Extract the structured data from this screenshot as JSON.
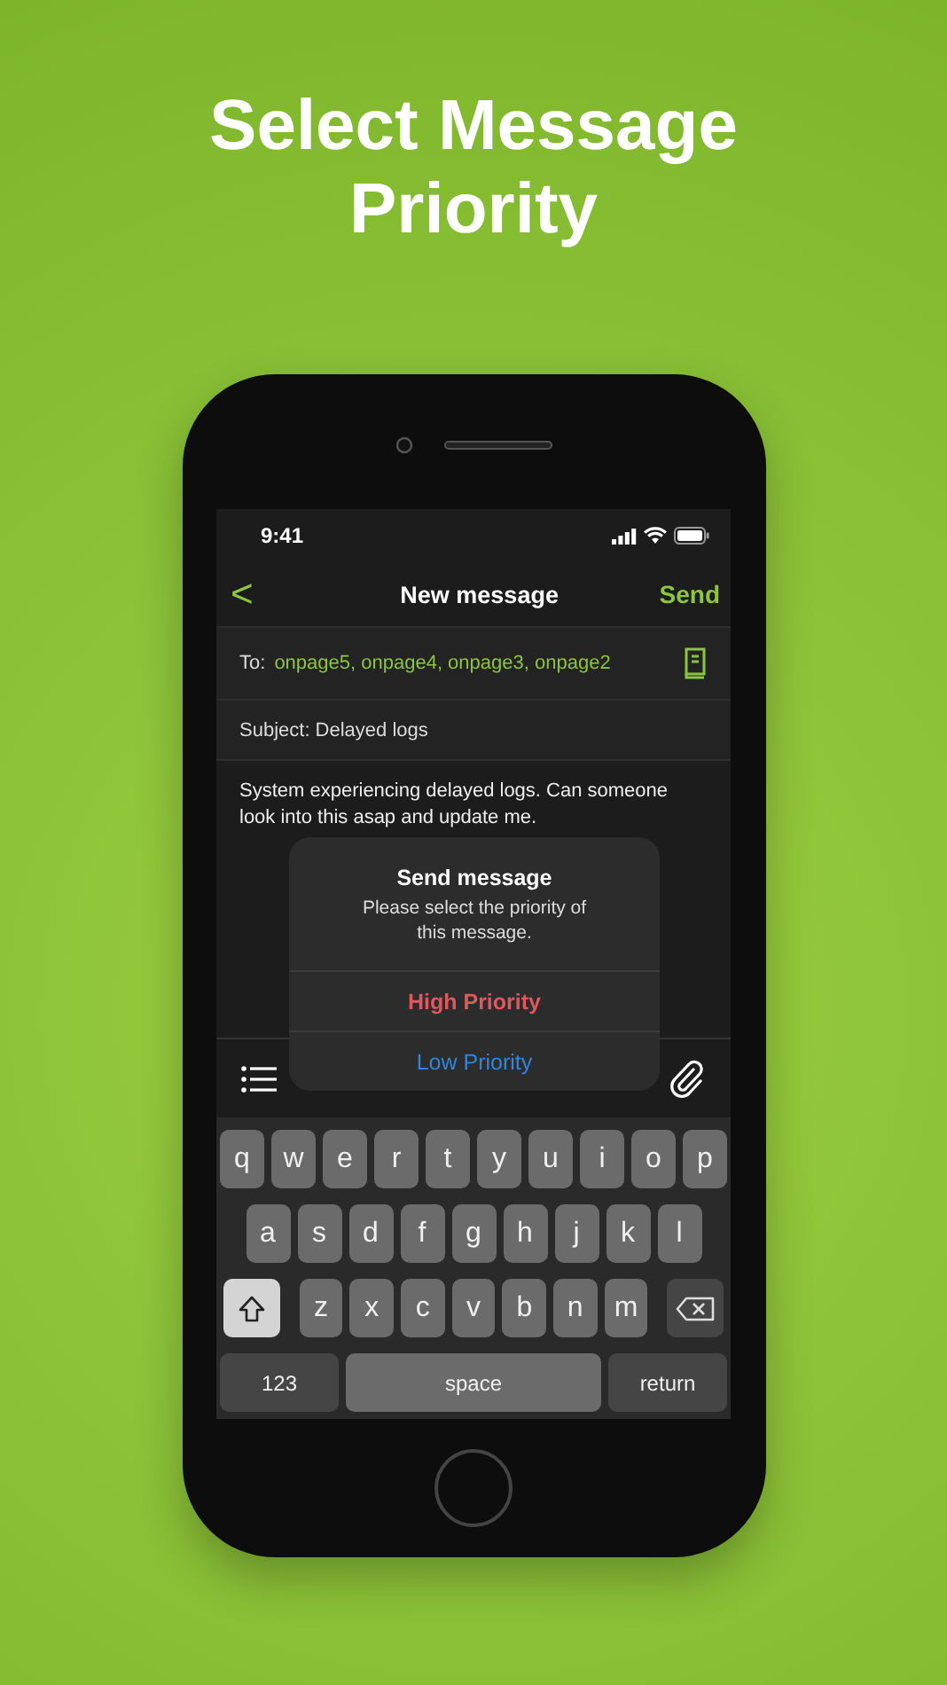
{
  "headline": "Select Message Priority",
  "status_bar": {
    "time": "9:41"
  },
  "nav": {
    "back": "<",
    "title": "New message",
    "action": "Send"
  },
  "to": {
    "label": "To:",
    "value": "onpage5, onpage4, onpage3, onpage2"
  },
  "subject": {
    "value": "Subject: Delayed logs"
  },
  "body": {
    "value": "System experiencing delayed logs. Can someone look into this asap and update me."
  },
  "alert": {
    "title": "Send message",
    "message": "Please select the priority of this message.",
    "actions": [
      {
        "label": "High Priority",
        "kind": "destructive"
      },
      {
        "label": "Low Priority",
        "kind": "default"
      }
    ]
  },
  "keyboard": {
    "rows": [
      [
        {
          "label": "q",
          "kind": "letter"
        },
        {
          "label": "w",
          "kind": "letter"
        },
        {
          "label": "e",
          "kind": "letter"
        },
        {
          "label": "r",
          "kind": "letter"
        },
        {
          "label": "t",
          "kind": "letter"
        },
        {
          "label": "y",
          "kind": "letter"
        },
        {
          "label": "u",
          "kind": "letter"
        },
        {
          "label": "i",
          "kind": "letter"
        },
        {
          "label": "o",
          "kind": "letter"
        },
        {
          "label": "p",
          "kind": "letter"
        }
      ],
      [
        {
          "label": "a",
          "kind": "letter"
        },
        {
          "label": "s",
          "kind": "letter"
        },
        {
          "label": "d",
          "kind": "letter"
        },
        {
          "label": "f",
          "kind": "letter"
        },
        {
          "label": "g",
          "kind": "letter"
        },
        {
          "label": "h",
          "kind": "letter"
        },
        {
          "label": "j",
          "kind": "letter"
        },
        {
          "label": "k",
          "kind": "letter"
        },
        {
          "label": "l",
          "kind": "letter"
        }
      ],
      [
        {
          "kind": "shift",
          "on": true
        },
        {
          "label": "z",
          "kind": "letter"
        },
        {
          "label": "x",
          "kind": "letter"
        },
        {
          "label": "c",
          "kind": "letter"
        },
        {
          "label": "v",
          "kind": "letter"
        },
        {
          "label": "b",
          "kind": "letter"
        },
        {
          "label": "n",
          "kind": "letter"
        },
        {
          "label": "m",
          "kind": "letter"
        },
        {
          "kind": "delete"
        }
      ]
    ],
    "bottom_keys": [
      {
        "label": "123",
        "kind": "mode"
      },
      {
        "label": "space",
        "kind": "space"
      },
      {
        "label": "return",
        "kind": "return"
      }
    ]
  }
}
